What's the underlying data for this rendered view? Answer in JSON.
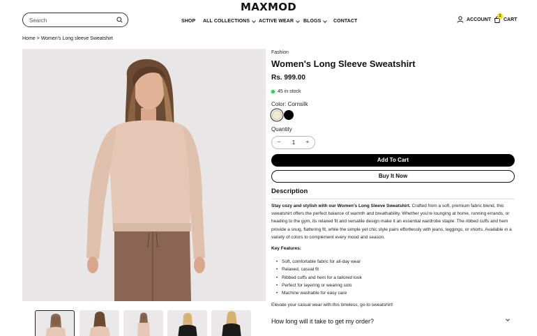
{
  "brand": {
    "logo": "MAXMOD"
  },
  "search": {
    "placeholder": "Search"
  },
  "nav": {
    "items": [
      {
        "label": "SHOP",
        "dropdown": false
      },
      {
        "label": "ALL COLLECTIONS",
        "dropdown": true
      },
      {
        "label": "ACTIVE WEAR",
        "dropdown": true
      },
      {
        "label": "BLOGS",
        "dropdown": true
      },
      {
        "label": "CONTACT",
        "dropdown": false
      }
    ]
  },
  "header": {
    "account_label": "ACCOUNT",
    "cart_label": "CART",
    "cart_count": "1"
  },
  "breadcrumb": {
    "home": "Home",
    "separator": ">",
    "current": "Women's Long sleeve Sweatshirt"
  },
  "product": {
    "category": "Fashion",
    "title": "Women's Long Sleeve Sweatshirt",
    "price": "Rs. 999.00",
    "stock_text": "45 in stock",
    "color_label": "Color: Cornsilk",
    "swatches": [
      {
        "name": "Cornsilk",
        "color": "#f3ead2",
        "selected": true
      },
      {
        "name": "Black",
        "color": "#000000",
        "selected": false
      }
    ],
    "quantity_label": "Quantity",
    "quantity_value": "1",
    "add_to_cart": "Add To Cart",
    "buy_now": "Buy It Now"
  },
  "description": {
    "heading": "Description",
    "lead_bold": "Stay cozy and stylish with our Women's Long Sleeve Sweatshirt.",
    "body": " Crafted from a soft, premium fabric blend, this sweatshirt offers the perfect balance of warmth and breathability. Whether you're lounging at home, running errands, or heading to the gym, its relaxed fit and versatile design make it an essential wardrobe staple. The ribbed cuffs and hem provide a snug, flattering fit, while the simple yet chic style pairs effortlessly with jeans, leggings, or shorts. Available in a variety of colors to complement every mood and season.",
    "features_heading": "Key Features:",
    "features": [
      "Soft, comfortable fabric for all-day wear",
      "Relaxed, casual fit",
      "Ribbed cuffs and hem for a tailored look",
      "Perfect for layering or wearing solo",
      "Machine washable for easy care"
    ],
    "closing": "Elevate your casual wear with this timeless, go-to sweatshirt!"
  },
  "faq": {
    "question": "How long will it take to get my order?"
  },
  "colors": {
    "accent": "#000000",
    "stock_dot": "#34c759",
    "cart_badge": "#f2e600",
    "image_bg": "#e9e6e7"
  }
}
